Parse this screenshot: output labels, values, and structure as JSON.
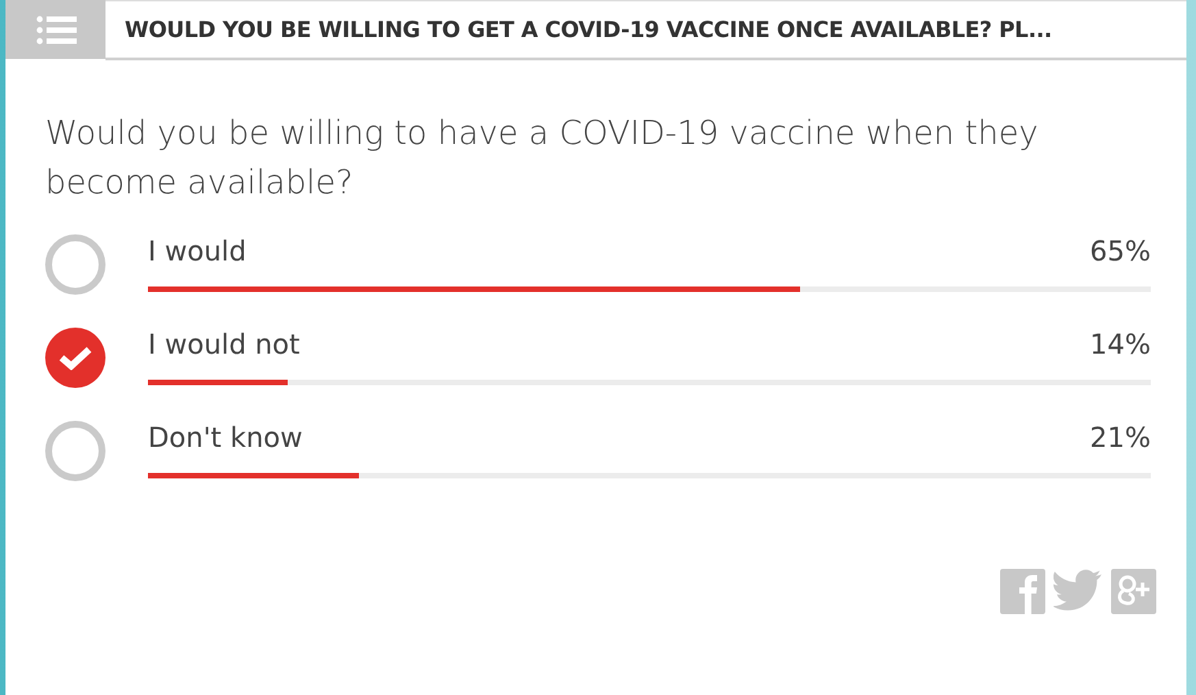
{
  "header": {
    "title": "WOULD YOU BE WILLING TO GET A COVID-19 VACCINE ONCE AVAILABLE? PL..."
  },
  "question": "Would you be willing to have a COVID-19 vaccine when they become available?",
  "options": [
    {
      "label": "I would",
      "reading": "65%",
      "level": 0.65,
      "selected": false
    },
    {
      "label": "I would not",
      "reading": "14%",
      "level": 0.14,
      "selected": true
    },
    {
      "label": "Don't know",
      "reading": "21%",
      "level": 0.21,
      "selected": false
    }
  ]
}
